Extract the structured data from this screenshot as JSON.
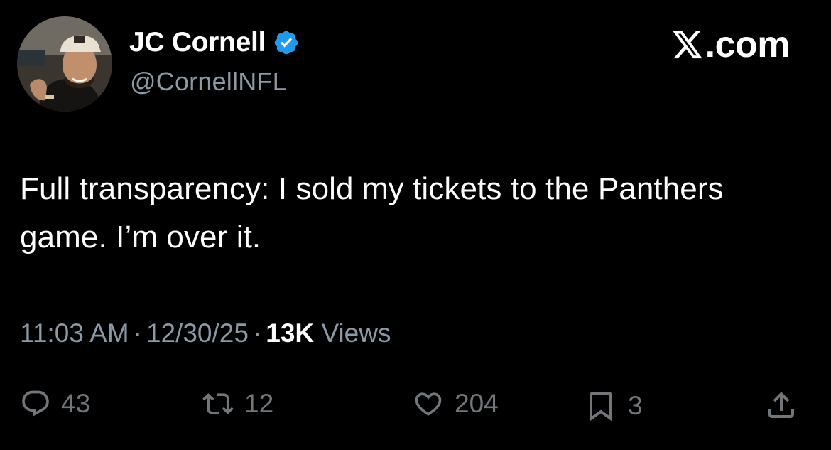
{
  "user": {
    "display_name": "JC Cornell",
    "handle": "@CornellNFL",
    "verified": true
  },
  "brand": {
    "logo_text": ".com"
  },
  "tweet": {
    "text": "Full transparency: I sold my tickets to the Panthers game. I’m over it.",
    "time": "11:03 AM",
    "date": "12/30/25",
    "separator": "·",
    "views_count": "13K",
    "views_label": "Views"
  },
  "actions": {
    "replies": "43",
    "reposts": "12",
    "likes": "204",
    "bookmarks": "3"
  },
  "colors": {
    "background": "#000000",
    "text": "#ffffff",
    "secondary": "#8b98a5",
    "icons": "#71767b",
    "verified": "#1d9bf0"
  },
  "icons": [
    "verified-badge-icon",
    "x-logo-icon",
    "reply-icon",
    "repost-icon",
    "like-icon",
    "bookmark-icon",
    "share-icon"
  ]
}
